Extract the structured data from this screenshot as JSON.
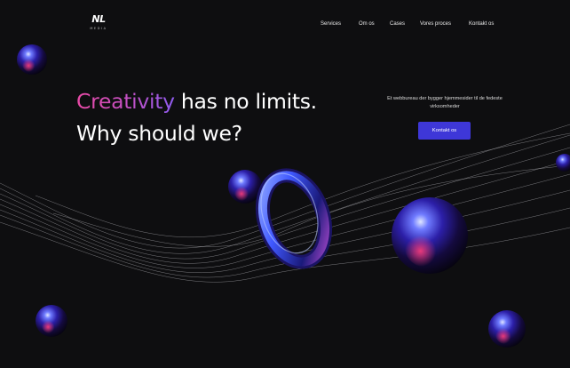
{
  "brand": {
    "logo_mark": "NL",
    "logo_sub": "MEDIA"
  },
  "nav": {
    "items": [
      {
        "label": "Services"
      },
      {
        "label": "Om os"
      },
      {
        "label": "Cases"
      },
      {
        "label": "Vores proces"
      },
      {
        "label": "Kontakt os"
      }
    ]
  },
  "hero": {
    "title_highlight": "Creativity",
    "title_rest": " has no limits.",
    "title_line2": "Why should we?",
    "tagline": "Et webbureau der bygger hjemmesider til de fedeste virksomheder",
    "cta_label": "Kontakt os"
  },
  "colors": {
    "background": "#0e0e10",
    "accent": "#3e37d8",
    "gradient_start": "#e94aa6",
    "gradient_end": "#8e5cf0"
  }
}
